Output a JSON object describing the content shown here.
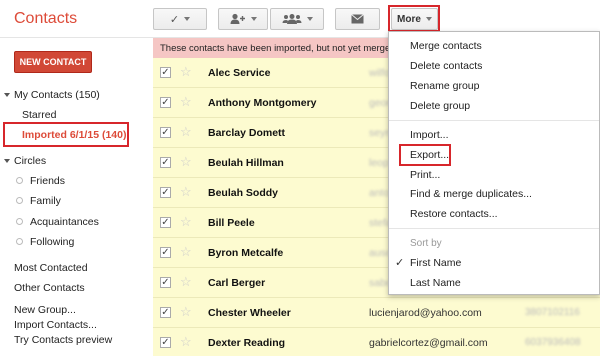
{
  "app": {
    "title": "Contacts"
  },
  "toolbar": {
    "select_icon": "checkmark-icon",
    "add_to_group_icon": "add-person-icon",
    "groups_icon": "group-icon",
    "email_icon": "envelope-icon",
    "more_label": "More"
  },
  "sidebar": {
    "new_contact_label": "NEW CONTACT",
    "my_contacts": "My Contacts (150)",
    "starred": "Starred",
    "imported": "Imported 6/1/15 (140)",
    "circles": "Circles",
    "circle_items": [
      "Friends",
      "Family",
      "Acquaintances",
      "Following"
    ],
    "most_contacted": "Most Contacted",
    "other_contacts": "Other Contacts",
    "new_group": "New Group...",
    "import_contacts": "Import Contacts...",
    "try_preview": "Try Contacts preview"
  },
  "banner": {
    "text": "These contacts have been imported, but not yet merge"
  },
  "contacts": [
    {
      "name": "Alec Service",
      "email": "wilfo",
      "phone": ""
    },
    {
      "name": "Anthony Montgomery",
      "email": "geor",
      "phone": ""
    },
    {
      "name": "Barclay Domett",
      "email": "seym",
      "phone": ""
    },
    {
      "name": "Beulah Hillman",
      "email": "leop",
      "phone": ""
    },
    {
      "name": "Beulah Soddy",
      "email": "anto",
      "phone": ""
    },
    {
      "name": "Bill Peele",
      "email": "stefa",
      "phone": ""
    },
    {
      "name": "Byron Metcalfe",
      "email": "auso",
      "phone": ""
    },
    {
      "name": "Carl Berger",
      "email": "sabo",
      "phone": ""
    },
    {
      "name": "Chester Wheeler",
      "email": "lucienjarod@yahoo.com",
      "phone": "3807102116"
    },
    {
      "name": "Dexter Reading",
      "email": "gabrielcortez@gmail.com",
      "phone": "6037936408"
    }
  ],
  "more_menu": {
    "items_group1": [
      "Merge contacts",
      "Delete contacts",
      "Rename group",
      "Delete group"
    ],
    "items_group2": [
      "Import...",
      "Export...",
      "Print...",
      "Find & merge duplicates...",
      "Restore contacts..."
    ],
    "sort_header": "Sort by",
    "sort_options": [
      "First Name",
      "Last Name"
    ],
    "sort_selected": "First Name",
    "check_icon": "checkmark-icon"
  },
  "colors": {
    "brand": "#dd4b39",
    "highlight": "#d7262b",
    "row_bg": "#fdfbd0",
    "banner_bg": "#f5c6c4"
  }
}
